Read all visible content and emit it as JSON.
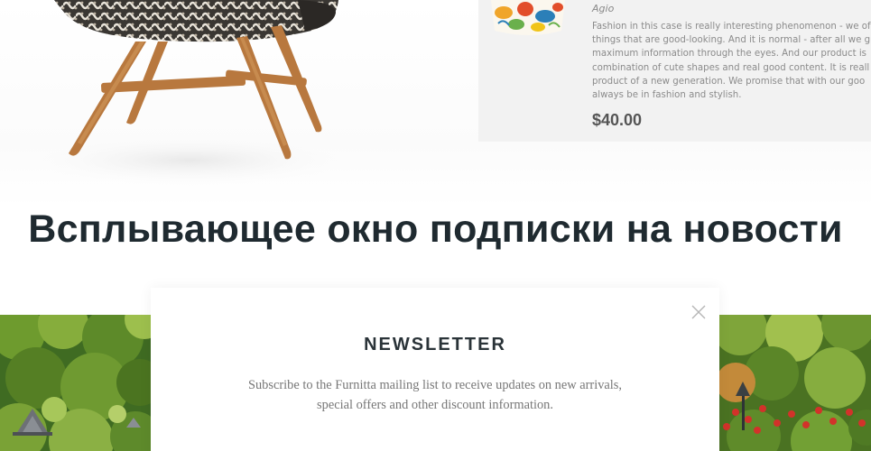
{
  "product": {
    "brand": "Agio",
    "description": "Fashion in this case is really interesting phenomenon - we of\nthings that are good-looking. And it is normal - after all we g\nmaximum information through the eyes. And our product is\ncombination of cute shapes and real good content. It is reall\nproduct of a new generation. We promise that with our goo\nalways be in fashion and stylish.",
    "price": "$40.00"
  },
  "page": {
    "heading": "Всплывающее окно подписки на новости"
  },
  "newsletter": {
    "title": "NEWSLETTER",
    "description": "Subscribe to the Furnitta mailing list to receive updates on new arrivals, special offers and other discount information.",
    "close_icon": "close-icon"
  },
  "colors": {
    "heading": "#1f2a30",
    "card_background": "#f2f2f2",
    "price": "#555555",
    "text_muted": "#777777"
  }
}
